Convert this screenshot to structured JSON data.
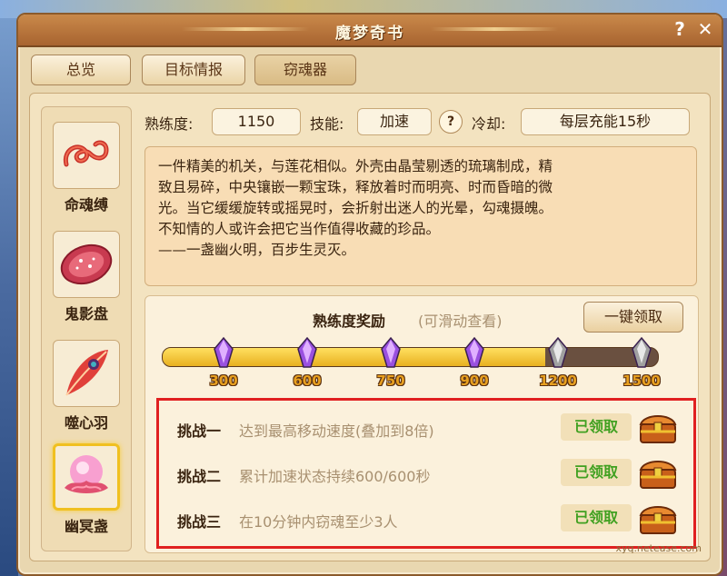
{
  "window": {
    "title": "魔梦奇书",
    "help": "?",
    "close": "✕"
  },
  "tabs": [
    {
      "label": "总览",
      "active": false
    },
    {
      "label": "目标情报",
      "active": false
    },
    {
      "label": "窃魂器",
      "active": true
    }
  ],
  "items": [
    {
      "label": "命魂缚",
      "icon": "rope-icon"
    },
    {
      "label": "鬼影盘",
      "icon": "disc-icon"
    },
    {
      "label": "噬心羽",
      "icon": "feather-icon"
    },
    {
      "label": "幽冥盏",
      "icon": "lotus-icon",
      "selected": true
    }
  ],
  "stats": {
    "proficiency_label": "熟练度:",
    "proficiency_value": "1150",
    "skill_label": "技能:",
    "skill_value": "加速",
    "skill_help": "?",
    "cooldown_label": "冷却:",
    "cooldown_value": "每层充能15秒"
  },
  "description": [
    "一件精美的机关，与莲花相似。外壳由晶莹剔透的琉璃制成，精",
    "致且易碎，中央镶嵌一颗宝珠，释放着时而明亮、时而昏暗的微",
    "光。当它缓缓旋转或摇晃时，会折射出迷人的光晕，勾魂摄魄。",
    "不知情的人或许会把它当作值得收藏的珍品。",
    "——一盏幽火明，百步生灵灭。"
  ],
  "reward": {
    "title": "熟练度奖励",
    "hint": "(可滑动查看)",
    "claim_all": "一键领取",
    "progress": 1150,
    "max": 1500,
    "milestones": [
      {
        "value": "300",
        "reached": true
      },
      {
        "value": "600",
        "reached": true
      },
      {
        "value": "750",
        "reached": true
      },
      {
        "value": "900",
        "reached": true
      },
      {
        "value": "1200",
        "reached": false
      },
      {
        "value": "1500",
        "reached": false
      }
    ]
  },
  "challenges": [
    {
      "name": "挑战一",
      "desc": "达到最高移动速度(叠加到8倍)",
      "status": "已领取"
    },
    {
      "name": "挑战二",
      "desc": "累计加速状态持续600/600秒",
      "status": "已领取"
    },
    {
      "name": "挑战三",
      "desc": "在10分钟内窃魂至少3人",
      "status": "已领取"
    }
  ],
  "colors": {
    "accent": "#e8b020",
    "highlight_border": "#e02020",
    "claimed": "#40a020"
  },
  "watermark": "xyq.netease.com"
}
